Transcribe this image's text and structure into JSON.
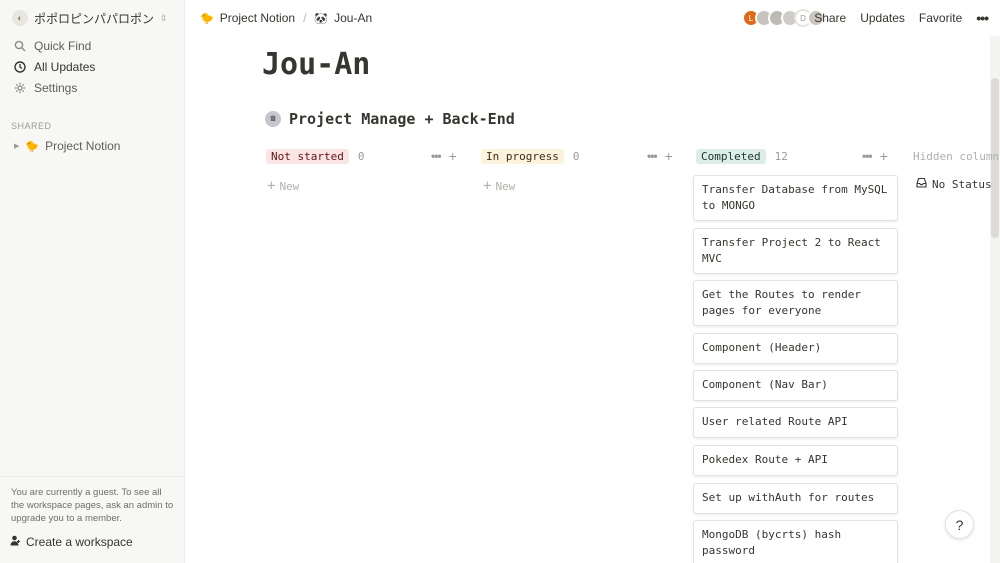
{
  "sidebar": {
    "workspace_name": "ポポロピンパパロポン",
    "items": [
      {
        "label": "Quick Find",
        "icon": "search-icon"
      },
      {
        "label": "All Updates",
        "icon": "clock-icon"
      },
      {
        "label": "Settings",
        "icon": "gear-icon"
      }
    ],
    "shared_label": "SHARED",
    "shared_pages": [
      {
        "label": "Project Notion",
        "emoji": "🐤"
      }
    ],
    "guest_note": "You are currently a guest. To see all the workspace pages, ask an admin to upgrade you to a member.",
    "create_workspace": "Create a workspace"
  },
  "topbar": {
    "breadcrumb": [
      {
        "label": "Project Notion",
        "emoji": "🐤"
      },
      {
        "label": "Jou-An",
        "emoji": "🐼"
      }
    ],
    "breadcrumb_sep": "/",
    "avatars": [
      {
        "letter": "L",
        "color": "#e16a16"
      },
      {
        "letter": "",
        "color": "#c7c4bf"
      },
      {
        "letter": "",
        "color": "#bdbab4"
      },
      {
        "letter": "",
        "color": "#d0cdc8"
      },
      {
        "letter": "D",
        "color": "#ffffff"
      },
      {
        "letter": "",
        "color": "#cbc6bd"
      }
    ],
    "share": "Share",
    "updates": "Updates",
    "favorite": "Favorite",
    "more": "•••"
  },
  "page": {
    "title": "Jou-An",
    "database_title": "Project Manage + Back-End",
    "columns": [
      {
        "label": "Not started",
        "count": "0",
        "color": "red"
      },
      {
        "label": "In progress",
        "count": "0",
        "color": "yellow"
      },
      {
        "label": "Completed",
        "count": "12",
        "color": "green"
      }
    ],
    "new_label": "New",
    "hidden_columns_label": "Hidden columns",
    "no_status_label": "No Status",
    "cards": [
      "Transfer Database from MySQL to MONGO",
      "Transfer Project 2 to React MVC",
      "Get the Routes to render pages for everyone",
      "Component (Header)",
      "Component (Nav Bar)",
      "User related Route API",
      "Pokedex Route + API",
      "Set up withAuth for routes",
      "MongoDB (bycrts) hash password"
    ]
  },
  "help": "?"
}
